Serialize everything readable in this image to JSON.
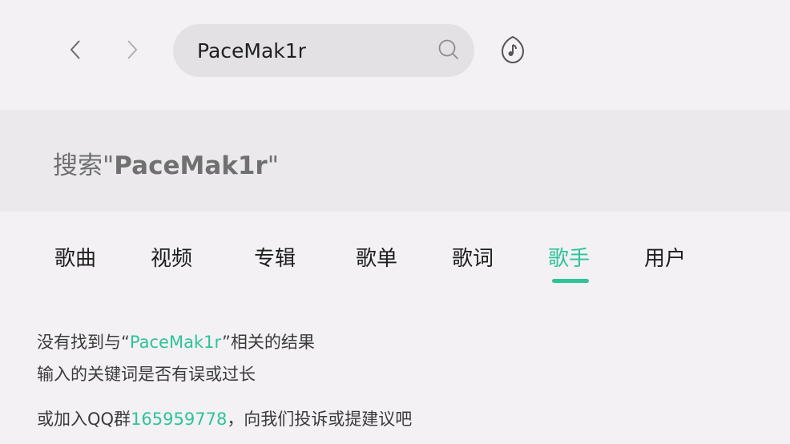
{
  "colors": {
    "accent": "#2ec398",
    "background": "#f3f1f4",
    "search_bg": "#e3e1e4",
    "header_bg": "#ebe9ec"
  },
  "toolbar": {
    "back_icon": "chevron-left-icon",
    "forward_icon": "chevron-right-icon",
    "search_value": "PaceMak1r",
    "search_icon": "search-icon",
    "listen_icon": "music-recognize-icon"
  },
  "result_header": {
    "prefix": "搜索\"",
    "query": "PaceMak1r",
    "suffix": "\""
  },
  "tabs": [
    {
      "label": "歌曲"
    },
    {
      "label": "视频"
    },
    {
      "label": "专辑"
    },
    {
      "label": "歌单"
    },
    {
      "label": "歌词"
    },
    {
      "label": "歌手",
      "active": true
    },
    {
      "label": "用户"
    }
  ],
  "empty_state": {
    "line1_prefix": "没有找到与",
    "line1_open_quote": "“",
    "line1_query": "PaceMak1r",
    "line1_close_quote": "”",
    "line1_suffix": "相关的结果",
    "line2": "输入的关键词是否有误或过长",
    "line3_prefix": "或加入QQ群",
    "line3_group": "165959778",
    "line3_suffix": "，向我们投诉或提建议吧"
  }
}
